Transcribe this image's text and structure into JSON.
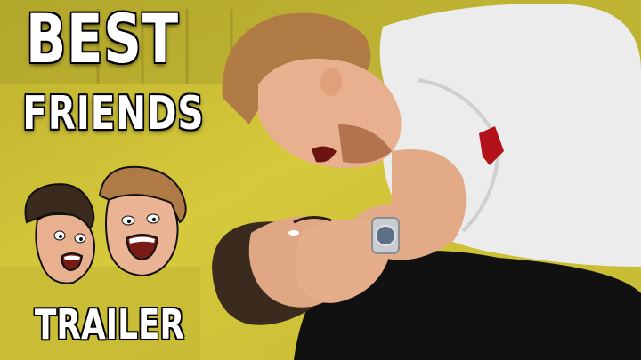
{
  "thumbnail": {
    "title_line1": "BEST",
    "title_line2": "FRIENDS",
    "subtitle": "TRAILER"
  },
  "colors": {
    "background": "#cfc23a",
    "background_shade": "#b4a82a",
    "title_text": "#ffffff",
    "sweater": "#ececec",
    "black_shirt": "#111111",
    "skin": "#e8b08e",
    "hair_blond": "#b07a45",
    "hair_dark": "#3b2a1e"
  },
  "icons": [
    "cartoon-duo-icon",
    "watch-icon"
  ]
}
